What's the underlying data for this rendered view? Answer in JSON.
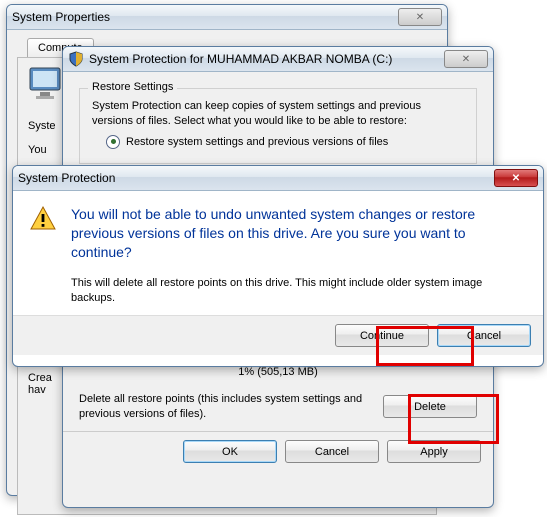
{
  "sysprops": {
    "title": "System Properties",
    "tab_general": "Compute",
    "sidebar_label_syste": "Syste",
    "sidebar_label_you": "You"
  },
  "protect_dlg": {
    "title": "System Protection for MUHAMMAD AKBAR NOMBA (C:)",
    "group_title": "Restore Settings",
    "desc": "System Protection can keep copies of system settings and previous versions of files. Select what you would like to be able to restore:",
    "radio1": "Restore system settings and previous versions of files",
    "usage_text": "1% (505,13 MB)",
    "delete_desc": "Delete all restore points (this includes system settings and previous versions of files).",
    "delete_btn": "Delete",
    "ok": "OK",
    "cancel": "Cancel",
    "apply": "Apply"
  },
  "confirm": {
    "title": "System Protection",
    "heading": "You will not be able to undo unwanted system changes or restore previous versions of files on this drive. Are you sure you want to continue?",
    "body": "This will delete all restore points on this drive. This might include older system image backups.",
    "continue": "Continue",
    "cancel": "Cancel"
  },
  "truncated": {
    "crea": "Crea",
    "hav": "hav"
  }
}
